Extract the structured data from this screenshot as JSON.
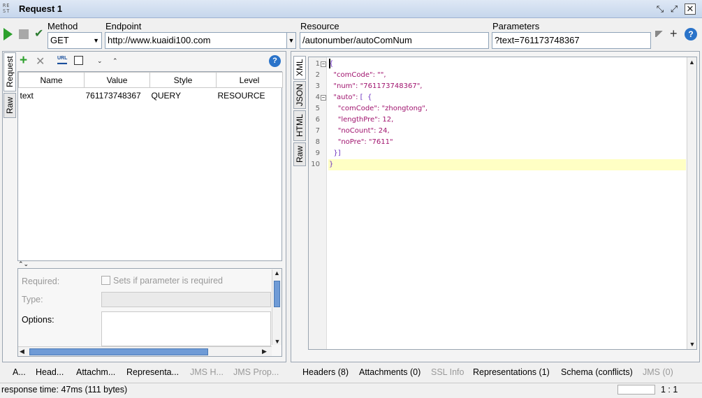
{
  "window": {
    "icon_text": "RE\nST",
    "title": "Request 1"
  },
  "toolbar": {
    "method_label": "Method",
    "method_value": "GET",
    "endpoint_label": "Endpoint",
    "endpoint_value": "http://www.kuaidi100.com",
    "resource_label": "Resource",
    "resource_value": "/autonumber/autoComNum",
    "parameters_label": "Parameters",
    "parameters_value": "?text=761173748367"
  },
  "request_tabs": [
    "Request",
    "Raw"
  ],
  "params_table": {
    "columns": [
      "Name",
      "Value",
      "Style",
      "Level"
    ],
    "rows": [
      {
        "name": "text",
        "value": "761173748367",
        "style": "QUERY",
        "level": "RESOURCE"
      }
    ]
  },
  "param_details": {
    "required_label": "Required:",
    "required_checkbox_label": "Sets if parameter is required",
    "type_label": "Type:",
    "options_label": "Options:"
  },
  "response_tabs": [
    "XML",
    "JSON",
    "HTML",
    "Raw"
  ],
  "response_lines": [
    {
      "n": "1",
      "t": "{"
    },
    {
      "n": "2",
      "t": "  \"comCode\": \"\","
    },
    {
      "n": "3",
      "t": "  \"num\": \"761173748367\","
    },
    {
      "n": "4",
      "t": "  \"auto\": [  {"
    },
    {
      "n": "5",
      "t": "    \"comCode\": \"zhongtong\","
    },
    {
      "n": "6",
      "t": "    \"lengthPre\": 12,"
    },
    {
      "n": "7",
      "t": "    \"noCount\": 24,"
    },
    {
      "n": "8",
      "t": "    \"noPre\": \"7611\""
    },
    {
      "n": "9",
      "t": "  }]"
    },
    {
      "n": "10",
      "t": "}"
    }
  ],
  "request_bottom_tabs": [
    "A...",
    "Head...",
    "Attachm...",
    "Representa...",
    "JMS H...",
    "JMS Prop..."
  ],
  "response_bottom_tabs": [
    "Headers (8)",
    "Attachments (0)",
    "SSL Info",
    "Representations (1)",
    "Schema (conflicts)",
    "JMS (0)"
  ],
  "status": {
    "response_time": "response time: 47ms (111 bytes)",
    "position": "1 : 1"
  },
  "colors": {
    "title_bg": "#c6d6ec",
    "run_green": "#2ca02c",
    "highlight_line": "#ffffc4",
    "json_key": "#a0136e"
  }
}
